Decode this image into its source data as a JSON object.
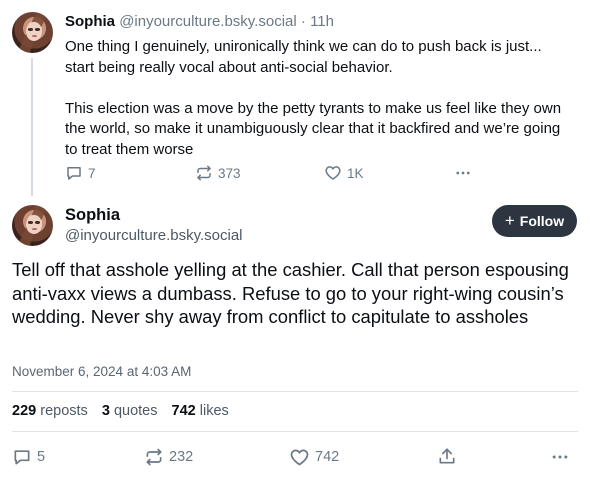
{
  "parent_post": {
    "author_name": "Sophia",
    "author_handle": "@inyourculture.bsky.social",
    "separator": "·",
    "time_ago": "11h",
    "paragraphs": [
      "One thing I genuinely, unironically think we can do to push back is just... start being really vocal about anti-social behavior.",
      "This election was a move by the petty tyrants to make us feel like they own the world, so make it unambiguously clear that it backfired and we’re going to treat them worse"
    ],
    "actions": {
      "reply_count": "7",
      "repost_count": "373",
      "like_count": "1K"
    }
  },
  "main_post": {
    "author_name": "Sophia",
    "author_handle": "@inyourculture.bsky.social",
    "follow_label": "Follow",
    "follow_icon": "+",
    "text": "Tell off that asshole yelling at the cashier. Call that person espousing anti-vaxx views a dumbass. Refuse to go to your right-wing cousin’s wedding. Never shy away from conflict to capitulate to assholes",
    "timestamp": "November 6, 2024 at 4:03 AM",
    "stats": {
      "reposts_count": "229",
      "reposts_label": "reposts",
      "quotes_count": "3",
      "quotes_label": "quotes",
      "likes_count": "742",
      "likes_label": "likes"
    },
    "actions": {
      "reply_count": "5",
      "repost_count": "232",
      "like_count": "742"
    }
  },
  "icons": {
    "reply": "speech-bubble-icon",
    "repost": "repost-arrows-icon",
    "like": "heart-icon",
    "share": "share-upload-icon",
    "more": "ellipsis-icon"
  },
  "colors": {
    "text": "#0b0f14",
    "muted": "#6b7886",
    "follow_button": "#2c3540",
    "thread_line": "#d4dbe2",
    "divider": "#dfe4e9"
  }
}
